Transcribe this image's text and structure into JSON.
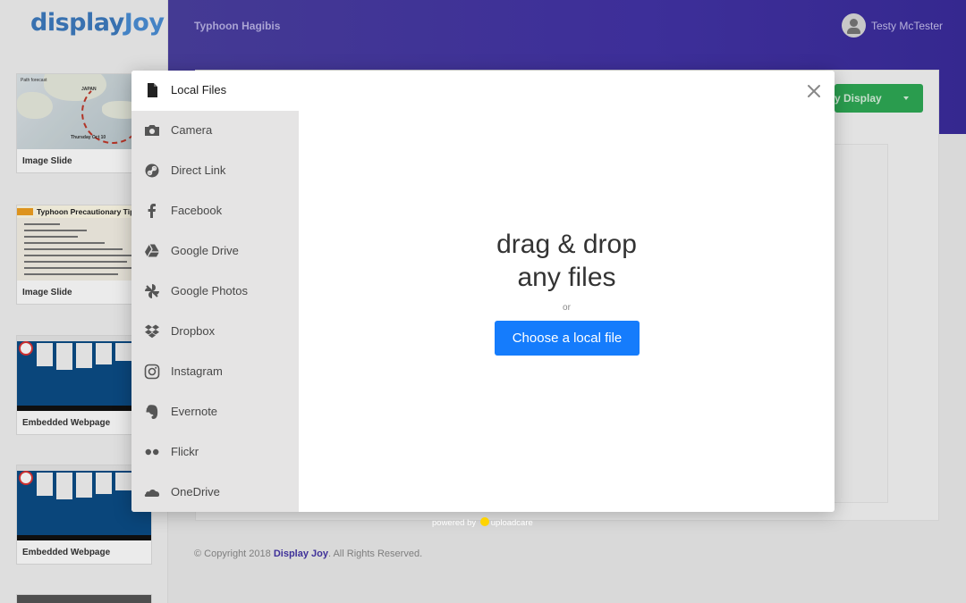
{
  "app": {
    "logo": "displayJoy",
    "header_title": "Typhoon Hagibis",
    "user_name": "Testy McTester",
    "primary_action": "y Display",
    "copyright_prefix": "© Copyright 2018 ",
    "copyright_brand": "Display Joy",
    "copyright_suffix": ". All Rights Reserved."
  },
  "slides": [
    {
      "label": "Image Slide",
      "thumb": "map"
    },
    {
      "label": "Image Slide",
      "thumb": "tips",
      "thumb_title": "Typhoon Precautionary Tips"
    },
    {
      "label": "Embedded Webpage",
      "thumb": "web"
    },
    {
      "label": "Embedded Webpage",
      "thumb": "web"
    }
  ],
  "dialog": {
    "tabs": [
      {
        "label": "Local Files",
        "icon": "file-icon",
        "active": true
      },
      {
        "label": "Camera",
        "icon": "camera-icon"
      },
      {
        "label": "Direct Link",
        "icon": "link-icon"
      },
      {
        "label": "Facebook",
        "icon": "facebook-icon"
      },
      {
        "label": "Google Drive",
        "icon": "google-drive-icon"
      },
      {
        "label": "Google Photos",
        "icon": "google-photos-icon"
      },
      {
        "label": "Dropbox",
        "icon": "dropbox-icon"
      },
      {
        "label": "Instagram",
        "icon": "instagram-icon"
      },
      {
        "label": "Evernote",
        "icon": "evernote-icon"
      },
      {
        "label": "Flickr",
        "icon": "flickr-icon"
      },
      {
        "label": "OneDrive",
        "icon": "onedrive-icon"
      }
    ],
    "dropzone": {
      "line1": "drag & drop",
      "line2": "any files",
      "or": "or",
      "button": "Choose a local file"
    },
    "powered_by": "powered by",
    "powered_brand": "uploadcare"
  },
  "colors": {
    "header": "#4333a6",
    "primary_button": "#157cfc",
    "green_button": "#2eaa55",
    "tab_background": "#e5e4e4"
  }
}
